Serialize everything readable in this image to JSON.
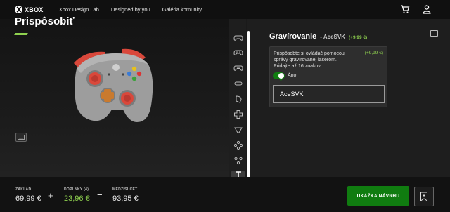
{
  "nav": {
    "brand": "XBOX",
    "links": [
      "Xbox Design Lab",
      "Designed by you",
      "Galéria komunity"
    ],
    "icons": [
      "cart-icon",
      "account-icon"
    ]
  },
  "stage": {
    "title": "Prispôsobiť",
    "accent_color": "#8fd14f"
  },
  "toolbar": {
    "icons": [
      "gamepad-icon",
      "controller-body-icon",
      "controller-back-icon",
      "bumper-icon",
      "trigger-icon",
      "dpad-icon",
      "thumbstick-icon",
      "buttons-icon",
      "face-buttons-icon",
      "text-engraving-icon"
    ],
    "active_index": 9
  },
  "panel": {
    "title": "Gravírovanie",
    "name_value": "AceSVK",
    "title_price": "(+9,99 €)",
    "card": {
      "description": "Prispôsobte si ovládač pomocou správy gravírovanej laserom. Pridajte až 16 znakov.",
      "price": "(+9,99 €)",
      "toggle_label": "Áno",
      "toggle_on": true,
      "input_value": "AceSVK"
    }
  },
  "bottom": {
    "base_label": "ZÁKLAD",
    "base_value": "69,99 €",
    "plus": "+",
    "addons_label": "DOPLNKY (4)",
    "addons_value": "23,96 €",
    "equals": "=",
    "subtotal_label": "MEDZISÚČET",
    "subtotal_value": "93,95 €",
    "cta_label": "UKÁŽKA NÁVRHU"
  },
  "colors": {
    "brand_green": "#107c10",
    "accent_green": "#8fd14f",
    "controller_body": "#9a9a9a",
    "controller_accent": "#d9483b"
  }
}
